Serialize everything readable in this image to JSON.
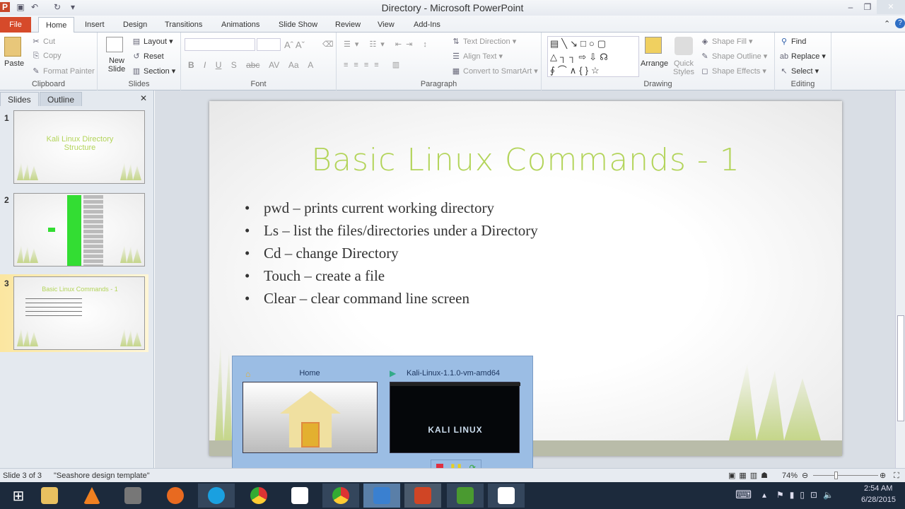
{
  "window": {
    "title": "Directory  -  Microsoft PowerPoint",
    "minimize": "–",
    "restore": "❐",
    "close": "✕"
  },
  "tabs": [
    "File",
    "Home",
    "Insert",
    "Design",
    "Transitions",
    "Animations",
    "Slide Show",
    "Review",
    "View",
    "Add-Ins"
  ],
  "ribbon": {
    "clipboard": {
      "label": "Clipboard",
      "paste": "Paste",
      "cut": "Cut",
      "copy": "Copy",
      "format_painter": "Format Painter"
    },
    "slides": {
      "label": "Slides",
      "new_slide": "New Slide",
      "layout": "Layout",
      "reset": "Reset",
      "section": "Section"
    },
    "font": {
      "label": "Font",
      "buttons": [
        "B",
        "I",
        "U",
        "S",
        "abc",
        "AV",
        "Aa",
        "A"
      ]
    },
    "paragraph": {
      "label": "Paragraph",
      "text_direction": "Text Direction",
      "align_text": "Align Text",
      "convert_smartart": "Convert to SmartArt"
    },
    "drawing": {
      "label": "Drawing",
      "arrange": "Arrange",
      "quick_styles": "Quick Styles",
      "shape_fill": "Shape Fill",
      "shape_outline": "Shape Outline",
      "shape_effects": "Shape Effects"
    },
    "editing": {
      "label": "Editing",
      "find": "Find",
      "replace": "Replace",
      "select": "Select"
    }
  },
  "panel": {
    "tab_slides": "Slides",
    "tab_outline": "Outline",
    "close": "✕",
    "thumbs": [
      {
        "num": "1",
        "title": "Kali Linux Directory Structure"
      },
      {
        "num": "2",
        "title": ""
      },
      {
        "num": "3",
        "title": "Basic Linux Commands - 1"
      }
    ]
  },
  "slide": {
    "title": "Basic Linux Commands - 1",
    "bullets": [
      "pwd – prints current working  directory",
      "Ls – list  the files/directories  under a Directory",
      "Cd – change Directory",
      "Touch – create a file",
      "Clear – clear command line screen"
    ]
  },
  "popup": {
    "home_label": "Home",
    "vm_label": "Kali-Linux-1.1.0-vm-amd64",
    "vm_screen_text": "KALI LINUX"
  },
  "status": {
    "slide": "Slide 3 of 3",
    "theme": "\"Seashore design template\"",
    "zoom": "74%"
  },
  "clock": {
    "time": "2:54 AM",
    "date": "6/28/2015"
  },
  "colors": {
    "accent": "#d64a2a",
    "title_green": "#b3d45a",
    "popup": "#9bbde4",
    "taskbar": "#1c2a3c"
  }
}
